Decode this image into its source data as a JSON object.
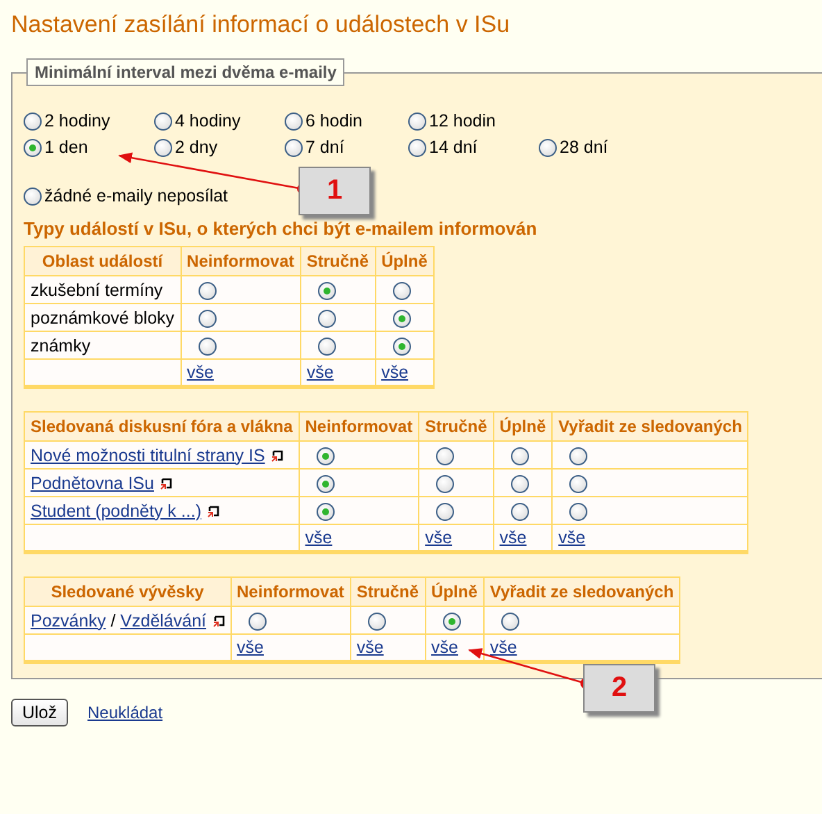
{
  "title": "Nastavení zasílání informací o událostech v ISu",
  "interval": {
    "legend": "Minimální interval mezi dvěma e-maily",
    "rows": [
      [
        {
          "label": "2 hodiny",
          "selected": false
        },
        {
          "label": "4 hodiny",
          "selected": false
        },
        {
          "label": "6 hodin",
          "selected": false
        },
        {
          "label": "12 hodin",
          "selected": false
        }
      ],
      [
        {
          "label": "1 den",
          "selected": true
        },
        {
          "label": "2 dny",
          "selected": false
        },
        {
          "label": "7 dní",
          "selected": false
        },
        {
          "label": "14 dní",
          "selected": false
        },
        {
          "label": "28 dní",
          "selected": false
        }
      ],
      [
        {
          "label": "žádné e-maily neposílat",
          "selected": false
        }
      ]
    ]
  },
  "events_heading": "Typy událostí v ISu, o kterých chci být e-mailem informován",
  "tables": [
    {
      "columns": [
        "Oblast událostí",
        "Neinformovat",
        "Stručně",
        "Úplně"
      ],
      "rows": [
        {
          "labels": [
            "zkušební termíny"
          ],
          "kind": "text",
          "choices": [
            {
              "selected": false
            },
            {
              "selected": true
            },
            {
              "selected": false
            }
          ]
        },
        {
          "labels": [
            "poznámkové bloky"
          ],
          "kind": "text",
          "choices": [
            {
              "selected": false
            },
            {
              "selected": false
            },
            {
              "selected": true
            }
          ]
        },
        {
          "labels": [
            "známky"
          ],
          "kind": "text",
          "choices": [
            {
              "selected": false
            },
            {
              "selected": false
            },
            {
              "selected": true
            }
          ]
        }
      ],
      "all_links": [
        "vše",
        "vše",
        "vše"
      ]
    },
    {
      "columns": [
        "Sledovaná diskusní fóra a vlákna",
        "Neinformovat",
        "Stručně",
        "Úplně",
        "Vyřadit ze sledovaných"
      ],
      "rows": [
        {
          "labels": [
            "Nové možnosti titulní strany IS"
          ],
          "kind": "link",
          "choices": [
            {
              "selected": true
            },
            {
              "selected": false
            },
            {
              "selected": false
            },
            {
              "selected": false
            }
          ]
        },
        {
          "labels": [
            "Podnětovna ISu"
          ],
          "kind": "link",
          "choices": [
            {
              "selected": true
            },
            {
              "selected": false
            },
            {
              "selected": false
            },
            {
              "selected": false
            }
          ]
        },
        {
          "labels": [
            "Student (podněty k ...)"
          ],
          "kind": "link",
          "choices": [
            {
              "selected": true
            },
            {
              "selected": false
            },
            {
              "selected": false
            },
            {
              "selected": false
            }
          ]
        }
      ],
      "all_links": [
        "vše",
        "vše",
        "vše",
        "vše"
      ]
    },
    {
      "columns": [
        "Sledované vývěsky",
        "Neinformovat",
        "Stručně",
        "Úplně",
        "Vyřadit ze sledovaných"
      ],
      "rows": [
        {
          "labels": [
            "Pozvánky",
            "Vzdělávání"
          ],
          "separator": "/",
          "kind": "link",
          "choices": [
            {
              "selected": false
            },
            {
              "selected": false
            },
            {
              "selected": true
            },
            {
              "selected": false
            }
          ]
        }
      ],
      "all_links": [
        "vše",
        "vše",
        "vše",
        "vše"
      ]
    }
  ],
  "save_button": "Ulož",
  "cancel_link": "Neukládat",
  "callouts": [
    "1",
    "2"
  ]
}
